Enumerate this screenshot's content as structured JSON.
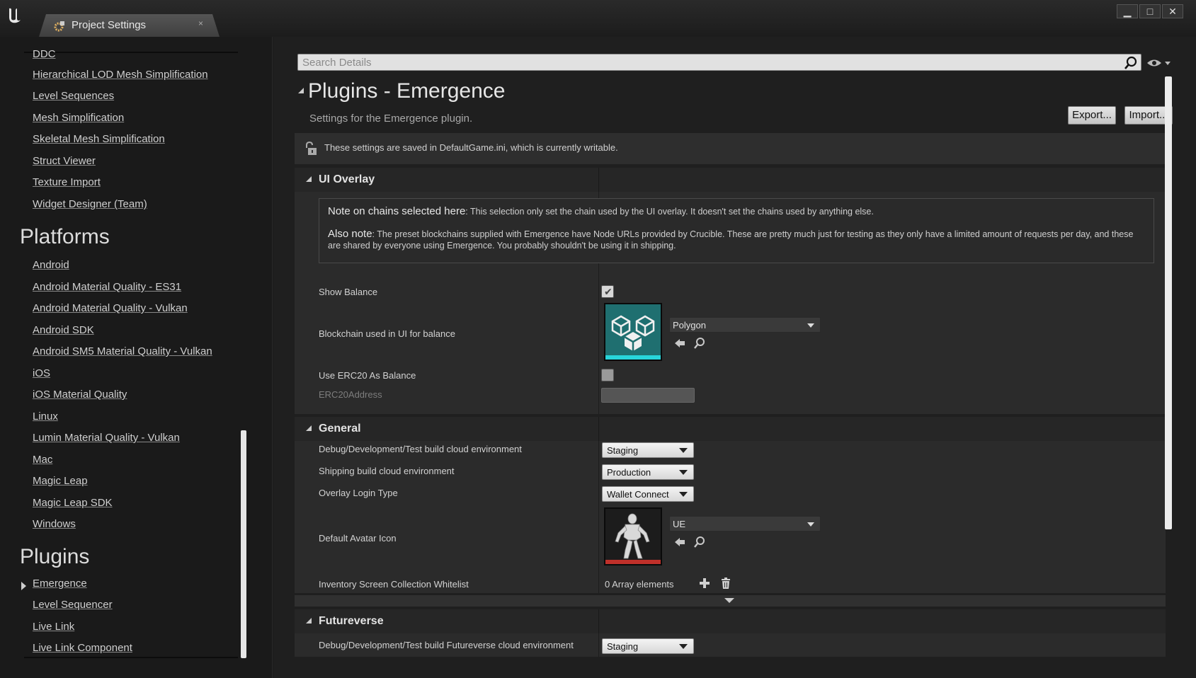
{
  "window": {
    "tab_title": "Project Settings",
    "tab_close": "×",
    "minimize": "▁",
    "maximize": "□",
    "close": "✕",
    "logo": "U"
  },
  "left_nav": {
    "items_top": [
      {
        "label": "DDC"
      },
      {
        "label": "Hierarchical LOD Mesh Simplification"
      },
      {
        "label": "Level Sequences"
      },
      {
        "label": "Mesh Simplification"
      },
      {
        "label": "Skeletal Mesh Simplification"
      },
      {
        "label": "Struct Viewer"
      },
      {
        "label": "Texture Import"
      },
      {
        "label": "Widget Designer (Team)"
      }
    ],
    "platforms_header": "Platforms",
    "platforms": [
      {
        "label": "Android"
      },
      {
        "label": "Android Material Quality - ES31"
      },
      {
        "label": "Android Material Quality - Vulkan"
      },
      {
        "label": "Android SDK"
      },
      {
        "label": "Android SM5 Material Quality - Vulkan"
      },
      {
        "label": "iOS"
      },
      {
        "label": "iOS Material Quality"
      },
      {
        "label": "Linux"
      },
      {
        "label": "Lumin Material Quality - Vulkan"
      },
      {
        "label": "Mac"
      },
      {
        "label": "Magic Leap"
      },
      {
        "label": "Magic Leap SDK"
      },
      {
        "label": "Windows"
      }
    ],
    "plugins_header": "Plugins",
    "plugins": [
      {
        "label": "Emergence"
      },
      {
        "label": "Level Sequencer"
      },
      {
        "label": "Live Link"
      },
      {
        "label": "Live Link Component"
      }
    ]
  },
  "details": {
    "search_placeholder": "Search Details",
    "title": "Plugins - Emergence",
    "subtitle": "Settings for the Emergence plugin.",
    "export_label": "Export...",
    "import_label": "Import...",
    "notice": "These settings are saved in DefaultGame.ini, which is currently writable.",
    "ui_overlay": {
      "header": "UI Overlay",
      "note1_bold": "Note on chains selected here",
      "note1_text": ": This selection only set the chain used by the UI overlay. It doesn't set the chains used by anything else.",
      "note2_bold": "Also note",
      "note2_text": ": The preset blockchains supplied with Emergence have Node URLs provided by Crucible. These are pretty much just for testing as they only have a limited amount of requests per day, and these are shared by everyone using Emergence. You probably shouldn't be using it in shipping.",
      "show_balance_label": "Show Balance",
      "show_balance_checked": true,
      "blockchain_label": "Blockchain used in UI for balance",
      "blockchain_value": "Polygon",
      "use_erc20_label": "Use ERC20 As Balance",
      "use_erc20_checked": false,
      "erc20_address_label": "ERC20Address",
      "erc20_address_value": ""
    },
    "general": {
      "header": "General",
      "debug_env_label": "Debug/Development/Test build cloud environment",
      "debug_env_value": "Staging",
      "shipping_env_label": "Shipping build cloud environment",
      "shipping_env_value": "Production",
      "login_type_label": "Overlay Login Type",
      "login_type_value": "Wallet Connect",
      "avatar_label": "Default Avatar Icon",
      "avatar_value": "UE",
      "whitelist_label": "Inventory Screen Collection Whitelist",
      "whitelist_value": "0 Array elements"
    },
    "futureverse": {
      "header": "Futureverse",
      "debug_env_label": "Debug/Development/Test build Futureverse cloud environment",
      "debug_env_value": "Staging"
    }
  },
  "colors": {
    "blockchain_thumb_bg": "#1f6f70",
    "blockchain_thumb_bar": "#28d5da",
    "avatar_thumb_bar": "#c0302a"
  }
}
